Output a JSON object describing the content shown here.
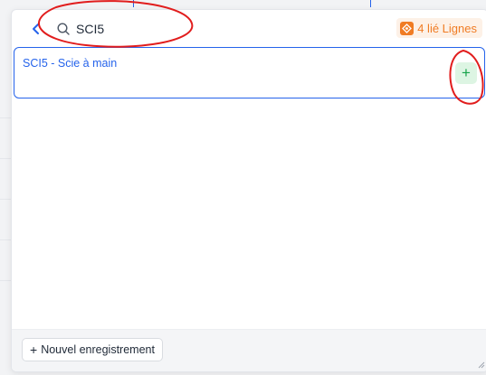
{
  "search": {
    "value": "SCI5",
    "placeholder": ""
  },
  "badge": {
    "label": "4 lié Lignes",
    "color": "#f07c24"
  },
  "results": [
    {
      "label": "SCI5 - Scie à main"
    }
  ],
  "footer": {
    "new_record_label": "Nouvel enregistrement"
  },
  "icons": {
    "back": "back-arrow-icon",
    "search": "search-icon",
    "badge": "linked-lines-icon",
    "add": "plus-icon",
    "resize": "resize-handle-icon"
  },
  "colors": {
    "accent": "#2563eb",
    "add_green": "#16a34a",
    "annotation_red": "#e11d1d"
  }
}
